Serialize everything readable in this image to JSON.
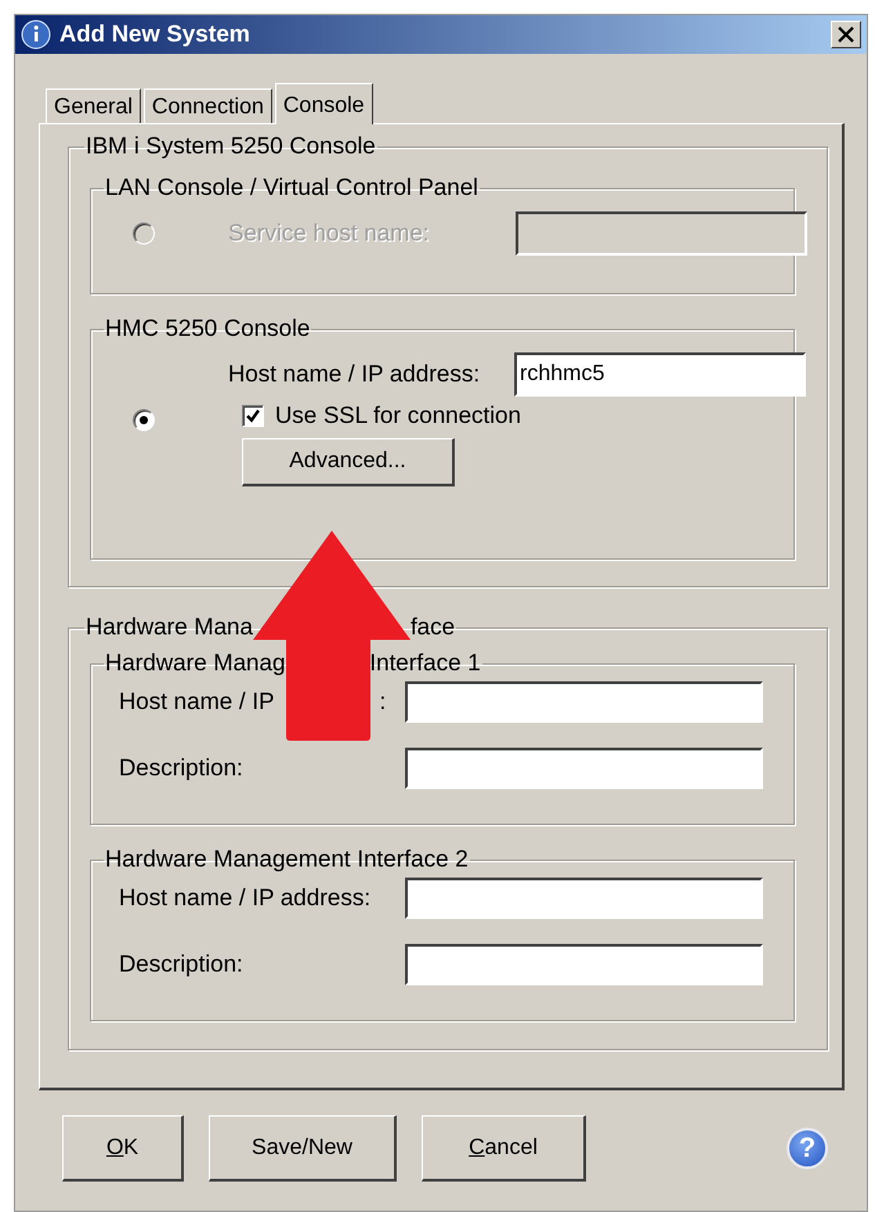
{
  "window": {
    "title": "Add New System"
  },
  "tabs": [
    {
      "label": "General",
      "selected": false
    },
    {
      "label": "Connection",
      "selected": false
    },
    {
      "label": "Console",
      "selected": true
    }
  ],
  "console_group": {
    "legend": "IBM i System 5250 Console",
    "lan": {
      "legend": "LAN Console / Virtual Control Panel",
      "selected": false,
      "disabled": true,
      "label": "Service host name:"
    },
    "hmc": {
      "legend": "HMC 5250 Console",
      "selected": true,
      "host_label": "Host name / IP address:",
      "host_value": "rchhmc5",
      "ssl": {
        "label": "Use SSL for connection",
        "checked": true
      },
      "advanced_button": "Advanced..."
    }
  },
  "hmi_group": {
    "legend_parts": [
      "Hardware Mana",
      "face"
    ],
    "interfaces": [
      {
        "legend_parts": [
          "Hardware Manag",
          "Interface 1"
        ],
        "host_label_parts": [
          "Host name / IP",
          ":"
        ],
        "description_label": "Description:"
      },
      {
        "legend_parts": [
          "Hardware Management Interface 2"
        ],
        "host_label_parts": [
          "Host name / IP address:"
        ],
        "description_label": "Description:"
      }
    ]
  },
  "buttons": [
    {
      "label": "OK",
      "mnemonic": true
    },
    {
      "label": "Save/New",
      "mnemonic": false
    },
    {
      "label": "Cancel",
      "mnemonic": true
    }
  ],
  "help_button": "?"
}
